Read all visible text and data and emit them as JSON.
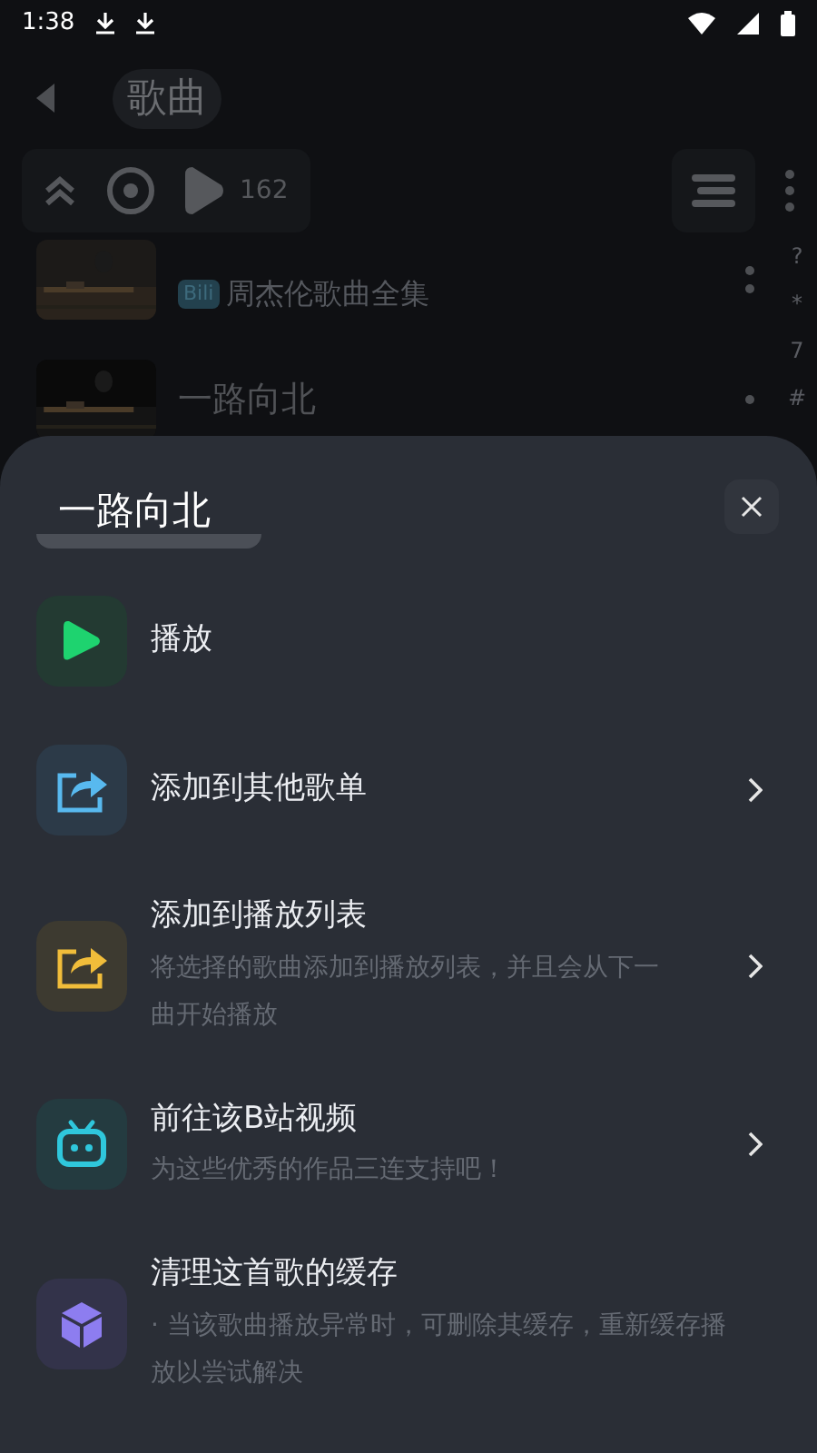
{
  "status_bar": {
    "time": "1:38"
  },
  "header": {
    "title": "歌曲"
  },
  "toolbar": {
    "count": "162"
  },
  "songs": [
    {
      "badge": "Bili",
      "subtitle": "周杰伦歌曲全集"
    },
    {
      "title": "一路向北"
    }
  ],
  "index_letters": [
    "?",
    "*",
    "7",
    "#"
  ],
  "sheet": {
    "title": "一路向北",
    "items": [
      {
        "kind": "play",
        "title": "播放",
        "chevron": false
      },
      {
        "kind": "share-blue",
        "title": "添加到其他歌单",
        "chevron": true
      },
      {
        "kind": "share-yellow",
        "title": "添加到播放列表",
        "subtitle": "将选择的歌曲添加到播放列表，并且会从下一曲开始播放",
        "chevron": true
      },
      {
        "kind": "bili",
        "title": "前往该B站视频",
        "subtitle": "为这些优秀的作品三连支持吧！",
        "chevron": true
      },
      {
        "kind": "cube",
        "title": "清理这首歌的缓存",
        "subtitle": "· 当该歌曲播放异常时，可删除其缓存，重新缓存播放以尝试解决",
        "chevron": false
      }
    ]
  }
}
